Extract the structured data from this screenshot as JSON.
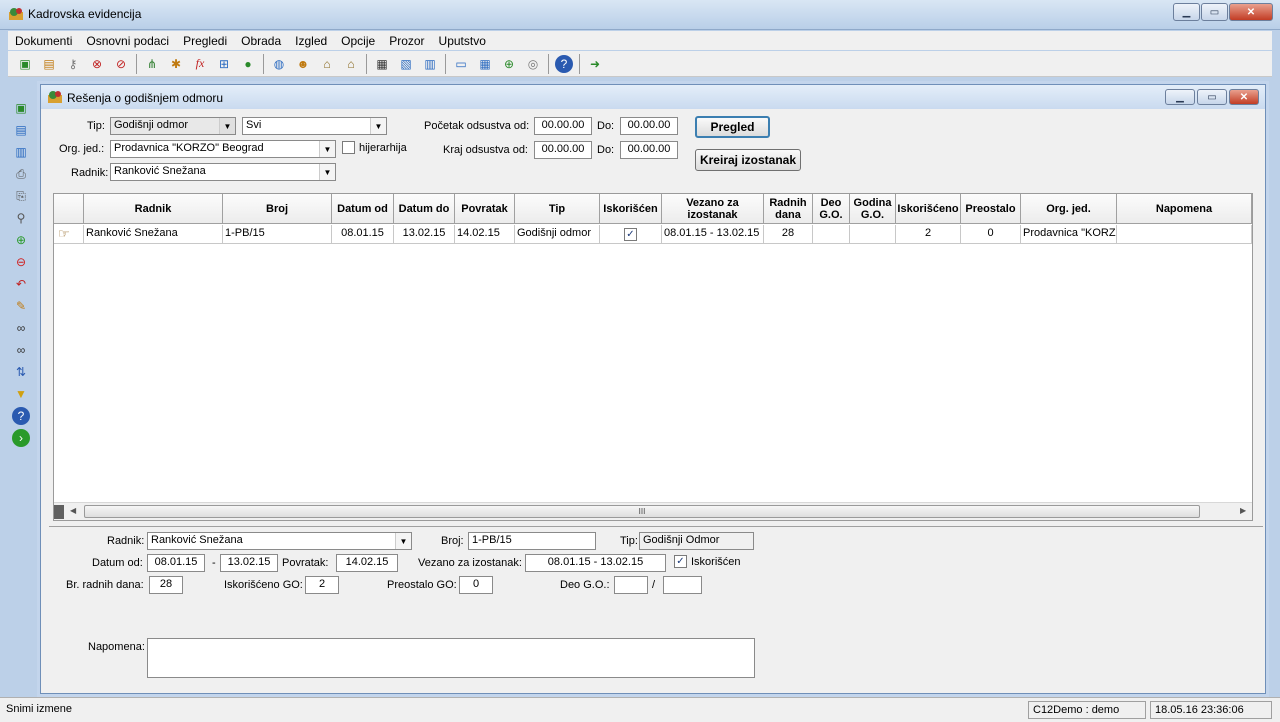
{
  "app": {
    "title": "Kadrovska evidencija"
  },
  "menu": [
    "Dokumenti",
    "Osnovni podaci",
    "Pregledi",
    "Obrada",
    "Izgled",
    "Opcije",
    "Prozor",
    "Uputstvo"
  ],
  "child": {
    "title": "Rešenja o godišnjem odmoru"
  },
  "filter": {
    "tip_label": "Tip:",
    "tip_value": "Godišnji odmor",
    "svi_value": "Svi",
    "org_label": "Org. jed.:",
    "org_value": "Prodavnica \"KORZO\" Beograd",
    "hijerarhija_label": "hijerarhija",
    "radnik_label": "Radnik:",
    "radnik_value": "Ranković Snežana",
    "pocetak_label": "Početak odsustva od:",
    "pocetak_od": "00.00.00",
    "do_label": "Do:",
    "pocetak_do": "00.00.00",
    "kraj_label": "Kraj odsustva od:",
    "kraj_od": "00.00.00",
    "kraj_do": "00.00.00",
    "pregled_button": "Pregled",
    "kreiraj_button": "Kreiraj izostanak"
  },
  "grid": {
    "headers": [
      "Radnik",
      "Broj",
      "Datum od",
      "Datum do",
      "Povratak",
      "Tip",
      "Iskorišćen",
      "Vezano za izostanak",
      "Radnih dana",
      "Deo G.O.",
      "Godina G.O.",
      "Iskorišćeno",
      "Preostalo",
      "Org. jed.",
      "Napomena"
    ],
    "row": {
      "radnik": "Ranković Snežana",
      "broj": "1-PB/15",
      "datum_od": "08.01.15",
      "datum_do": "13.02.15",
      "povratak": "14.02.15",
      "tip": "Godišnji odmor",
      "iskoriscen": true,
      "vezano": "08.01.15 - 13.02.15",
      "radnih_dana": "28",
      "deo_go": "",
      "godina_go": "",
      "iskorisceno": "2",
      "preostalo": "0",
      "org": "Prodavnica \"KORZO",
      "napomena": ""
    },
    "scroll_grip": "III"
  },
  "detail": {
    "radnik_label": "Radnik:",
    "radnik_value": "Ranković Snežana",
    "broj_label": "Broj:",
    "broj_value": "1-PB/15",
    "tip_label": "Tip:",
    "tip_value": "Godišnji Odmor",
    "datum_od_label": "Datum od:",
    "datum_od": "08.01.15",
    "dash": "-",
    "datum_do": "13.02.15",
    "povratak_label": "Povratak:",
    "povratak": "14.02.15",
    "vezano_label": "Vezano za izostanak:",
    "vezano": "08.01.15 - 13.02.15",
    "iskoriscen_label": "Iskorišćen",
    "br_dana_label": "Br. radnih dana:",
    "br_dana": "28",
    "iskorisceno_label": "Iskorišćeno GO:",
    "iskorisceno": "2",
    "preostalo_label": "Preostalo GO:",
    "preostalo": "0",
    "deo_label": "Deo G.O.:",
    "slash": "/",
    "napomena_label": "Napomena:"
  },
  "status": {
    "message": "Snimi izmene",
    "user": "C12Demo : demo",
    "datetime": "18.05.16 23:36:06"
  }
}
